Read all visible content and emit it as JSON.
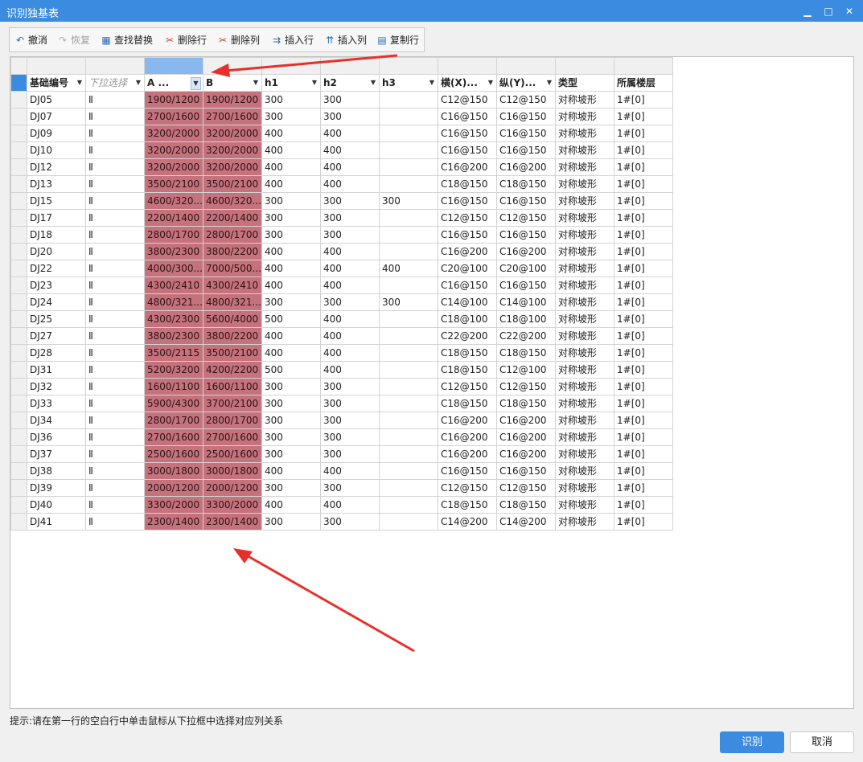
{
  "window": {
    "title": "识别独基表"
  },
  "toolbar": {
    "undo": "撤消",
    "redo": "恢复",
    "find_replace": "查找替换",
    "delete_row": "删除行",
    "delete_col": "删除列",
    "insert_row": "插入行",
    "insert_col": "插入列",
    "copy_row": "复制行"
  },
  "table": {
    "columns": [
      "基础编号",
      "下拉选择",
      "A",
      "B",
      "h1",
      "h2",
      "h3",
      "横(X)...",
      "纵(Y)...",
      "类型",
      "所属楼层"
    ],
    "col_a_header": "A ...",
    "rows": [
      [
        "DJ05",
        "Ⅱ",
        "1900/1200",
        "1900/1200",
        "300",
        "300",
        "",
        "C12@150",
        "C12@150",
        "对称坡形",
        "1#[0]"
      ],
      [
        "DJ07",
        "Ⅱ",
        "2700/1600",
        "2700/1600",
        "300",
        "300",
        "",
        "C16@150",
        "C16@150",
        "对称坡形",
        "1#[0]"
      ],
      [
        "DJ09",
        "Ⅱ",
        "3200/2000",
        "3200/2000",
        "400",
        "400",
        "",
        "C16@150",
        "C16@150",
        "对称坡形",
        "1#[0]"
      ],
      [
        "DJ10",
        "Ⅱ",
        "3200/2000",
        "3200/2000",
        "400",
        "400",
        "",
        "C16@150",
        "C16@150",
        "对称坡形",
        "1#[0]"
      ],
      [
        "DJ12",
        "Ⅱ",
        "3200/2000",
        "3200/2000",
        "400",
        "400",
        "",
        "C16@200",
        "C16@200",
        "对称坡形",
        "1#[0]"
      ],
      [
        "DJ13",
        "Ⅱ",
        "3500/2100",
        "3500/2100",
        "400",
        "400",
        "",
        "C18@150",
        "C18@150",
        "对称坡形",
        "1#[0]"
      ],
      [
        "DJ15",
        "Ⅱ",
        "4600/320...",
        "4600/320...",
        "300",
        "300",
        "300",
        "C16@150",
        "C16@150",
        "对称坡形",
        "1#[0]"
      ],
      [
        "DJ17",
        "Ⅱ",
        "2200/1400",
        "2200/1400",
        "300",
        "300",
        "",
        "C12@150",
        "C12@150",
        "对称坡形",
        "1#[0]"
      ],
      [
        "DJ18",
        "Ⅱ",
        "2800/1700",
        "2800/1700",
        "300",
        "300",
        "",
        "C16@150",
        "C16@150",
        "对称坡形",
        "1#[0]"
      ],
      [
        "DJ20",
        "Ⅱ",
        "3800/2300",
        "3800/2200",
        "400",
        "400",
        "",
        "C16@200",
        "C16@200",
        "对称坡形",
        "1#[0]"
      ],
      [
        "DJ22",
        "Ⅱ",
        "4000/300...",
        "7000/500...",
        "400",
        "400",
        "400",
        "C20@100",
        "C20@100",
        "对称坡形",
        "1#[0]"
      ],
      [
        "DJ23",
        "Ⅱ",
        "4300/2410",
        "4300/2410",
        "400",
        "400",
        "",
        "C16@150",
        "C16@150",
        "对称坡形",
        "1#[0]"
      ],
      [
        "DJ24",
        "Ⅱ",
        "4800/321...",
        "4800/321...",
        "300",
        "300",
        "300",
        "C14@100",
        "C14@100",
        "对称坡形",
        "1#[0]"
      ],
      [
        "DJ25",
        "Ⅱ",
        "4300/2300",
        "5600/4000",
        "500",
        "400",
        "",
        "C18@100",
        "C18@100",
        "对称坡形",
        "1#[0]"
      ],
      [
        "DJ27",
        "Ⅱ",
        "3800/2300",
        "3800/2200",
        "400",
        "400",
        "",
        "C22@200",
        "C22@200",
        "对称坡形",
        "1#[0]"
      ],
      [
        "DJ28",
        "Ⅱ",
        "3500/2115",
        "3500/2100",
        "400",
        "400",
        "",
        "C18@150",
        "C18@150",
        "对称坡形",
        "1#[0]"
      ],
      [
        "DJ31",
        "Ⅱ",
        "5200/3200",
        "4200/2200",
        "500",
        "400",
        "",
        "C18@150",
        "C12@100",
        "对称坡形",
        "1#[0]"
      ],
      [
        "DJ32",
        "Ⅱ",
        "1600/1100",
        "1600/1100",
        "300",
        "300",
        "",
        "C12@150",
        "C12@150",
        "对称坡形",
        "1#[0]"
      ],
      [
        "DJ33",
        "Ⅱ",
        "5900/4300",
        "3700/2100",
        "300",
        "300",
        "",
        "C18@150",
        "C18@150",
        "对称坡形",
        "1#[0]"
      ],
      [
        "DJ34",
        "Ⅱ",
        "2800/1700",
        "2800/1700",
        "300",
        "300",
        "",
        "C16@200",
        "C16@200",
        "对称坡形",
        "1#[0]"
      ],
      [
        "DJ36",
        "Ⅱ",
        "2700/1600",
        "2700/1600",
        "300",
        "300",
        "",
        "C16@200",
        "C16@200",
        "对称坡形",
        "1#[0]"
      ],
      [
        "DJ37",
        "Ⅱ",
        "2500/1600",
        "2500/1600",
        "300",
        "300",
        "",
        "C16@200",
        "C16@200",
        "对称坡形",
        "1#[0]"
      ],
      [
        "DJ38",
        "Ⅱ",
        "3000/1800",
        "3000/1800",
        "400",
        "400",
        "",
        "C16@150",
        "C16@150",
        "对称坡形",
        "1#[0]"
      ],
      [
        "DJ39",
        "Ⅱ",
        "2000/1200",
        "2000/1200",
        "300",
        "300",
        "",
        "C12@150",
        "C12@150",
        "对称坡形",
        "1#[0]"
      ],
      [
        "DJ40",
        "Ⅱ",
        "3300/2000",
        "3300/2000",
        "400",
        "400",
        "",
        "C18@150",
        "C18@150",
        "对称坡形",
        "1#[0]"
      ],
      [
        "DJ41",
        "Ⅱ",
        "2300/1400",
        "2300/1400",
        "300",
        "300",
        "",
        "C14@200",
        "C14@200",
        "对称坡形",
        "1#[0]"
      ]
    ]
  },
  "hint": "提示:请在第一行的空白行中单击鼠标从下拉框中选择对应列关系",
  "buttons": {
    "ok": "识别",
    "cancel": "取消"
  },
  "colors": {
    "accent": "#3b8be0",
    "selected_cell": "#c5727c",
    "arrow": "#e8302a"
  }
}
